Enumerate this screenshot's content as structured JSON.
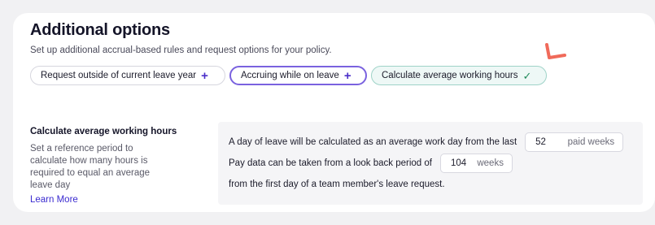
{
  "header": {
    "title": "Additional options",
    "subtitle": "Set up additional accrual-based rules and request options for your policy."
  },
  "chips": [
    {
      "label": "Request outside of current leave year",
      "icon": "plus-icon",
      "glyph": "+"
    },
    {
      "label": "Accruing while on leave",
      "icon": "plus-icon",
      "glyph": "+"
    },
    {
      "label": "Calculate average working hours",
      "icon": "check-icon",
      "glyph": "✓"
    }
  ],
  "side": {
    "title": "Calculate average working hours",
    "description": "Set a reference period to calculate how many hours is required to equal an average leave day",
    "learn_more": "Learn More"
  },
  "settings": {
    "row1_text": "A day of leave will be calculated as an average work day from the last",
    "paid_weeks_value": "52",
    "paid_weeks_unit": "paid weeks",
    "row2_text": "Pay data can be taken from a look back period of",
    "lookback_value": "104",
    "lookback_unit": "weeks",
    "row3_text": "from the first day of a team member's leave request."
  },
  "colors": {
    "accent": "#4b2fc9",
    "selected_border": "#7a62df",
    "success": "#1f8a5a",
    "annotation": "#f06a5a"
  }
}
